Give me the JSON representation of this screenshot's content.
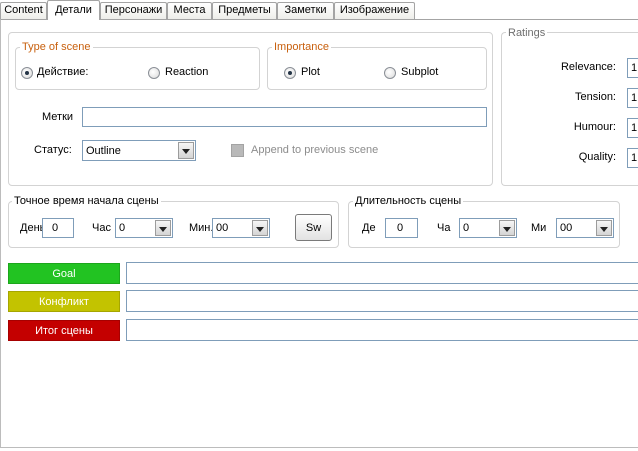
{
  "tabs": [
    {
      "label": "Content",
      "active": false
    },
    {
      "label": "Детали",
      "active": true
    },
    {
      "label": "Персонажи",
      "active": false
    },
    {
      "label": "Места",
      "active": false
    },
    {
      "label": "Предметы",
      "active": false
    },
    {
      "label": "Заметки",
      "active": false
    },
    {
      "label": "Изображение",
      "active": false
    }
  ],
  "type_of_scene": {
    "title": "Type of scene",
    "options": [
      {
        "label": "Действие:",
        "selected": true
      },
      {
        "label": "Reaction",
        "selected": false
      }
    ]
  },
  "importance": {
    "title": "Importance",
    "options": [
      {
        "label": "Plot",
        "selected": true
      },
      {
        "label": "Subplot",
        "selected": false
      }
    ]
  },
  "tags": {
    "label": "Метки"
  },
  "status": {
    "label": "Статус:",
    "value": "Outline"
  },
  "append_to_previous": {
    "label": "Append to previous scene",
    "checked": false,
    "enabled": false
  },
  "ratings": {
    "title": "Ratings",
    "items": [
      {
        "label": "Relevance:",
        "value": "1"
      },
      {
        "label": "Tension:",
        "value": "1"
      },
      {
        "label": "Humour:",
        "value": "1"
      },
      {
        "label": "Quality:",
        "value": "1"
      }
    ]
  },
  "start_time": {
    "title": "Точное время начала сцены",
    "day_label": "День",
    "day_value": "0",
    "hour_label": "Час",
    "hour_value": "0",
    "minute_label": "Мин.",
    "minute_value": "00",
    "switch_label": "Sw"
  },
  "duration": {
    "title": "Длительность сцены",
    "day_label": "Де",
    "day_value": "0",
    "hour_label": "Ча",
    "hour_value": "0",
    "minute_label": "Ми",
    "minute_value": "00"
  },
  "outcome_rows": [
    {
      "label": "Goal",
      "color": "#22c322"
    },
    {
      "label": "Конфликт",
      "color": "#c3c300"
    },
    {
      "label": "Итог сцены",
      "color": "#c40000"
    }
  ],
  "colors": {
    "group_title_accent": "#c8600e",
    "group_title_muted": "#6e6e6e",
    "disabled_text": "#8c8c8c"
  },
  "icons": {
    "dropdown_arrow": "chevron-down-icon"
  }
}
